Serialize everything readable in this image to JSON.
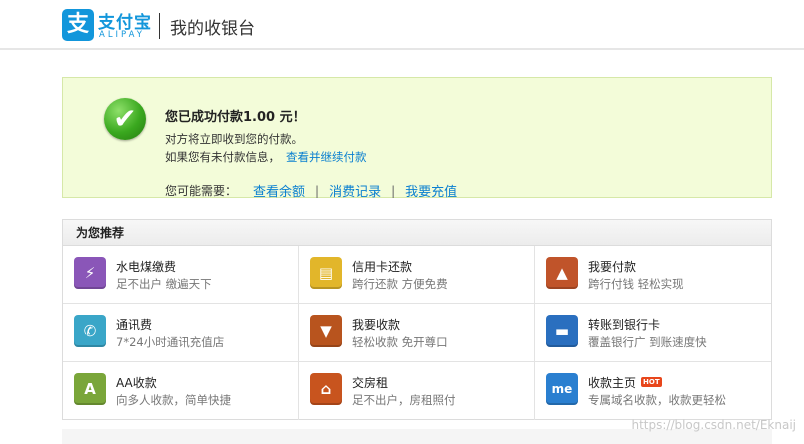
{
  "header": {
    "logo_icon": "支",
    "logo_cn": "支付宝",
    "logo_en": "ALIPAY",
    "title": "我的收银台"
  },
  "success": {
    "icon": "check-circle-icon",
    "title": "您已成功付款1.00 元！",
    "line1": "对方将立即收到您的付款。",
    "line2_prefix": "如果您有未付款信息，",
    "line2_link": "查看并继续付款",
    "need_label": "您可能需要：",
    "links": [
      "查看余额",
      "消费记录",
      "我要充值"
    ],
    "separator": "|"
  },
  "recommend": {
    "title": "为您推荐",
    "items": [
      {
        "title": "水电煤缴费",
        "desc": "足不出户  缴遍天下",
        "icon": "utility-icon",
        "glyph": "⚡",
        "color": "#8a56b8"
      },
      {
        "title": "信用卡还款",
        "desc": "跨行还款  方便免费",
        "icon": "credit-card-icon",
        "glyph": "▤",
        "color": "#e2b62a"
      },
      {
        "title": "我要付款",
        "desc": "跨行付钱  轻松实现",
        "icon": "pay-icon",
        "glyph": "▲",
        "color": "#c0542a"
      },
      {
        "title": "通讯费",
        "desc": "7*24小时通讯充值店",
        "icon": "phone-icon",
        "glyph": "✆",
        "color": "#3aa6c8"
      },
      {
        "title": "我要收款",
        "desc": "轻松收款  免开尊口",
        "icon": "receive-icon",
        "glyph": "▼",
        "color": "#b8541e"
      },
      {
        "title": "转账到银行卡",
        "desc": "覆盖银行广  到账速度快",
        "icon": "bank-transfer-icon",
        "glyph": "▬",
        "color": "#2a6fbf"
      },
      {
        "title": "AA收款",
        "desc": "向多人收款，简单快捷",
        "icon": "aa-icon",
        "glyph": "A",
        "color": "#7aa63a"
      },
      {
        "title": "交房租",
        "desc": "足不出户，房租照付",
        "icon": "rent-icon",
        "glyph": "⌂",
        "color": "#c8541e"
      },
      {
        "title": "收款主页",
        "desc": "专属域名收款，收款更轻松",
        "icon": "homepage-icon",
        "glyph": "me",
        "color": "#2a7fd0",
        "badge": "HOT"
      }
    ]
  },
  "watermark": "https://blog.csdn.net/Eknaij"
}
